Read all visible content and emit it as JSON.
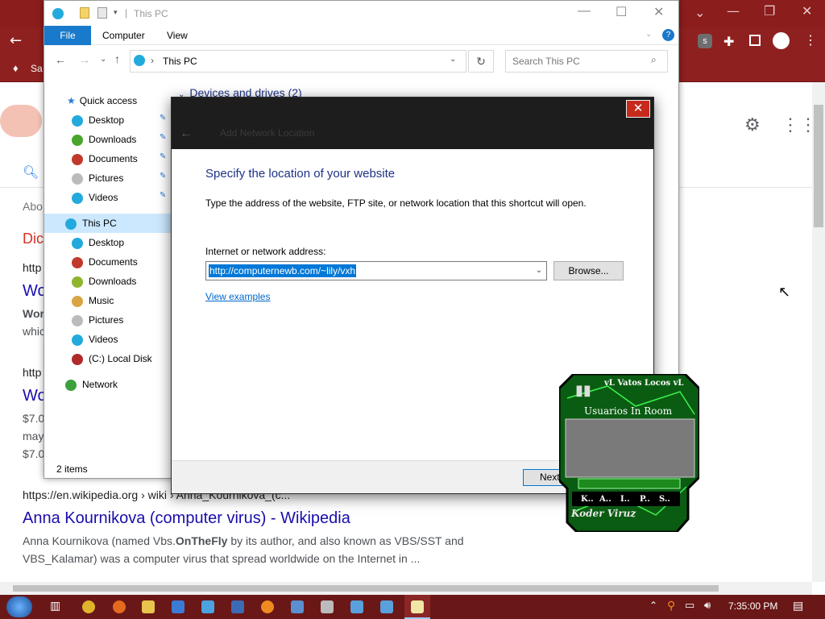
{
  "chrome": {
    "bookmark_text": "Sa",
    "tab_text": ""
  },
  "google": {
    "results": [
      {
        "label": "Abo"
      },
      {
        "label": "Dic"
      },
      {
        "label": "http"
      },
      {
        "label": "Wo"
      },
      {
        "label": "Wor"
      },
      {
        "label": "whic"
      },
      {
        "label": "http"
      },
      {
        "label": "Wo"
      },
      {
        "label": "$7.0"
      },
      {
        "label": "may"
      },
      {
        "label": "$7.0"
      }
    ],
    "wiki_url": "https://en.wikipedia.org › wiki › Anna_Kournikova_(c...",
    "wiki_title": "Anna Kournikova (computer virus) - Wikipedia",
    "wiki_snippet_1a": "Anna Kournikova (named Vbs.",
    "wiki_snippet_1b": "OnTheFly",
    "wiki_snippet_1c": " by its author, and also known as VBS/SST and",
    "wiki_snippet_2": "VBS_Kalamar) was a computer virus that spread worldwide on the Internet in ..."
  },
  "explorer": {
    "title": "This PC",
    "ribbon_tabs": [
      "File",
      "Computer",
      "View"
    ],
    "address": "This PC",
    "search_placeholder": "Search This PC",
    "section_header": "Devices and drives (2)",
    "nav": [
      {
        "label": "Quick access",
        "color": "#2b79d6"
      },
      {
        "label": "Desktop",
        "color": "#22aadd"
      },
      {
        "label": "Downloads",
        "color": "#49a52b"
      },
      {
        "label": "Documents",
        "color": "#c0392b"
      },
      {
        "label": "Pictures",
        "color": "#bbbbbb"
      },
      {
        "label": "Videos",
        "color": "#22aadd"
      },
      {
        "label": "This PC",
        "color": "#22aadd"
      },
      {
        "label": "Desktop",
        "color": "#22aadd"
      },
      {
        "label": "Documents",
        "color": "#c0392b"
      },
      {
        "label": "Downloads",
        "color": "#8db62c"
      },
      {
        "label": "Music",
        "color": "#d9a441"
      },
      {
        "label": "Pictures",
        "color": "#bbbbbb"
      },
      {
        "label": "Videos",
        "color": "#22aadd"
      },
      {
        "label": "(C:) Local Disk",
        "color": "#b02a2a"
      },
      {
        "label": "Network",
        "color": "#3ca03c"
      }
    ],
    "status": "2 items"
  },
  "dialog": {
    "title": "Add Network Location",
    "heading": "Specify the location of your website",
    "description": "Type the address of the website, FTP site, or network location that this shortcut will open.",
    "address_label": "Internet or network address:",
    "address_value": "http://computernewb.com/~lily/vxh",
    "browse_label": "Browse...",
    "examples_link": "View examples",
    "next_label": "Next",
    "close_glyph": "✕"
  },
  "widget": {
    "title": "vL Vatos Locos vL",
    "subtitle": "Usuarios In Room",
    "buttons": [
      "K..",
      "A..",
      "I..",
      "P..",
      "S.."
    ],
    "footer": "Koder Viruz"
  },
  "taskbar": {
    "time": "7:35:00 PM"
  }
}
